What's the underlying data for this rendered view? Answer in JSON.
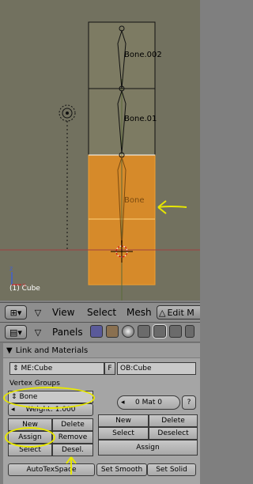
{
  "viewport": {
    "bone_labels": [
      "Bone.002",
      "Bone.01",
      "Bone"
    ],
    "object_label": "(1) Cube"
  },
  "header": {
    "menu_view": "View",
    "menu_select": "Select",
    "menu_mesh": "Mesh",
    "mode": "Edit M"
  },
  "panels_header": {
    "label": "Panels"
  },
  "panel": {
    "title": "Link and Materials",
    "me_field": "ME:Cube",
    "f_label": "F",
    "ob_field": "OB:Cube",
    "vertex_groups_label": "Vertex Groups",
    "group_name": "Bone",
    "weight": "Weight: 1.000",
    "mat": "0 Mat 0",
    "mat_help": "?",
    "vg_buttons": {
      "new": "New",
      "delete": "Delete",
      "assign": "Assign",
      "remove": "Remove",
      "select": "Select",
      "desel": "Desel."
    },
    "mat_buttons": {
      "new": "New",
      "delete": "Delete",
      "select": "Select",
      "deselect": "Deselect",
      "assign": "Assign"
    },
    "autotexspace": "AutoTexSpace",
    "set_smooth": "Set Smooth",
    "set_solid": "Set Solid"
  },
  "colors": {
    "viewport_bg": "#72715f",
    "selected_face": "#d68a2a",
    "annotation": "#e8e800"
  }
}
